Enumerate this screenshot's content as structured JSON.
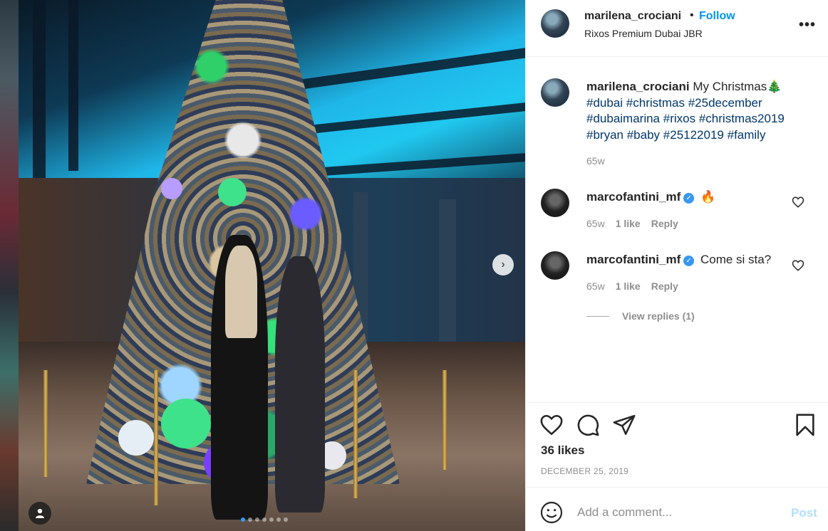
{
  "header": {
    "username": "marilena_crociani",
    "separator": "•",
    "follow_label": "Follow",
    "location": "Rixos Premium Dubai JBR",
    "more_label": "•••"
  },
  "caption": {
    "username": "marilena_crociani",
    "text": "My Christmas🎄",
    "hashtags": [
      "#dubai",
      "#christmas",
      "#25december",
      "#dubaimarina",
      "#rixos",
      "#christmas2019",
      "#bryan",
      "#baby",
      "#25122019",
      "#family"
    ],
    "time": "65w"
  },
  "comments": [
    {
      "username": "marcofantini_mf",
      "text": "🔥",
      "time": "65w",
      "likes": "1 like",
      "reply_label": "Reply"
    },
    {
      "username": "marcofantini_mf",
      "text": "Come si sta?",
      "time": "65w",
      "likes": "1 like",
      "reply_label": "Reply"
    }
  ],
  "view_replies": "View replies (1)",
  "likes_count": "36 likes",
  "date": "DECEMBER 25, 2019",
  "comment_box": {
    "placeholder": "Add a comment...",
    "post_label": "Post"
  },
  "carousel": {
    "total_images": 7,
    "current_index": 0,
    "next_glyph": "›"
  },
  "colors": {
    "accent": "#0095f6",
    "hashtag": "#00376b",
    "muted": "#8e8e8e",
    "post_disabled": "#b2dffc",
    "verified": "#3897f0"
  },
  "icons": [
    "heart-icon",
    "comment-icon",
    "share-icon",
    "bookmark-icon",
    "smile-icon",
    "user-tag-icon",
    "verified-badge-icon",
    "chevron-right-icon",
    "more-options-icon"
  ]
}
